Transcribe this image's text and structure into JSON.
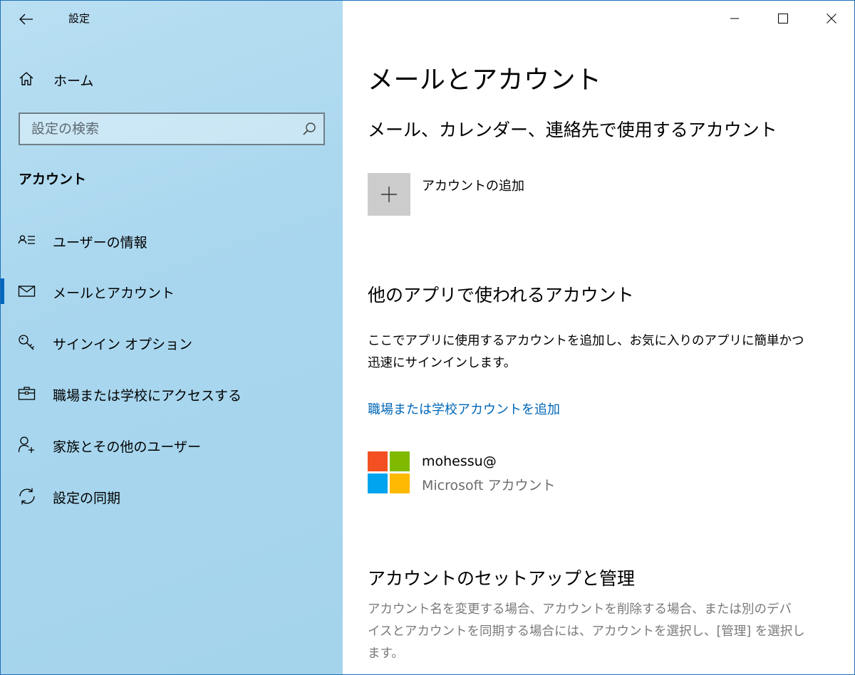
{
  "app": {
    "title": "設定"
  },
  "sidebar": {
    "home_label": "ホーム",
    "search_placeholder": "設定の検索",
    "section_title": "アカウント",
    "items": [
      {
        "label": "ユーザーの情報",
        "icon": "user-info-icon",
        "active": false
      },
      {
        "label": "メールとアカウント",
        "icon": "mail-icon",
        "active": true
      },
      {
        "label": "サインイン オプション",
        "icon": "key-icon",
        "active": false
      },
      {
        "label": "職場または学校にアクセスする",
        "icon": "briefcase-icon",
        "active": false
      },
      {
        "label": "家族とその他のユーザー",
        "icon": "add-user-icon",
        "active": false
      },
      {
        "label": "設定の同期",
        "icon": "sync-icon",
        "active": false
      }
    ]
  },
  "main": {
    "title": "メールとアカウント",
    "mail_section": {
      "heading": "メール、カレンダー、連絡先で使用するアカウント",
      "add_account_label": "アカウントの追加"
    },
    "other_apps_section": {
      "heading": "他のアプリで使われるアカウント",
      "description_line1": "ここでアプリに使用するアカウントを追加し、お気に入りのアプリに簡単かつ",
      "description_line2": "迅速にサインインします。",
      "link": "職場または学校アカウントを追加",
      "account": {
        "email": "mohessu@",
        "type": "Microsoft アカウント"
      }
    },
    "manage_section": {
      "heading": "アカウントのセットアップと管理",
      "description_line1": "アカウント名を変更する場合、アカウントを削除する場合、または別のデバ",
      "description_line2": "イスとアカウントを同期する場合には、アカウントを選択し、[管理] を選択し",
      "description_line3": "ます。"
    }
  },
  "colors": {
    "accent": "#0067c0",
    "link": "#0067b8",
    "ms_red": "#f25022",
    "ms_green": "#7fba00",
    "ms_blue": "#00a4ef",
    "ms_yellow": "#ffb900"
  }
}
